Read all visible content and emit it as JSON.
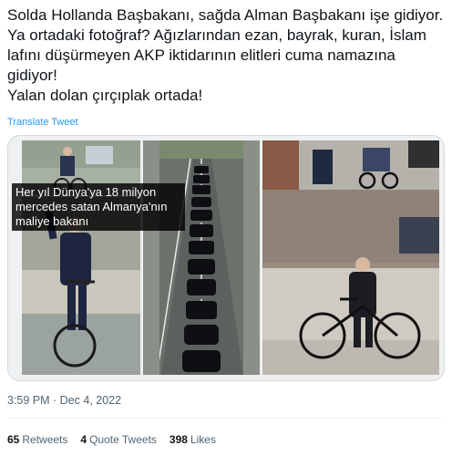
{
  "tweet": {
    "text": "Solda Hollanda Başbakanı, sağda Alman Başbakanı işe gidiyor. Ya ortadaki fotoğraf? Ağızlarından ezan, bayrak, kuran, İslam lafını düşürmeyen AKP iktidarının elitleri cuma namazına gidiyor!\nYalan dolan çırçıplak ortada!",
    "translate_label": "Translate Tweet",
    "timestamp": "3:59 PM · Dec 4, 2022"
  },
  "media": {
    "caption": "Her yıl Dünya'ya 18 milyon mercedes satan Almanya'nın maliye bakanı"
  },
  "stats": {
    "retweets_count": "65",
    "retweets_label": "Retweets",
    "quote_count": "4",
    "quote_label": "Quote Tweets",
    "likes_count": "398",
    "likes_label": "Likes"
  },
  "colors": {
    "link": "#1d9bf0",
    "text": "#0f1419",
    "muted": "#536471"
  }
}
